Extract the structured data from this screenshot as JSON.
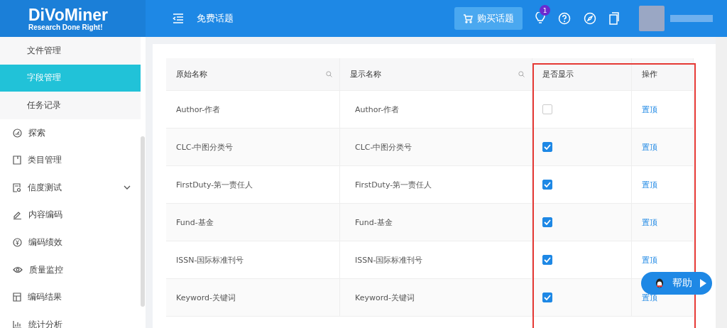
{
  "header": {
    "logo": "DiVoMiner",
    "tagline": "Research Done Right!",
    "page_title": "免费话题",
    "buy_button": "购买话题",
    "notification_badge": "1"
  },
  "sidebar": {
    "items": [
      {
        "label": "文件管理",
        "kind": "sub",
        "selected": false
      },
      {
        "label": "字段管理",
        "kind": "sub",
        "selected": true
      },
      {
        "label": "任务记录",
        "kind": "sub",
        "selected": false
      },
      {
        "label": "探索",
        "kind": "link",
        "selected": false
      },
      {
        "label": "类目管理",
        "kind": "link",
        "selected": false
      },
      {
        "label": "信度测试",
        "kind": "group",
        "selected": false
      },
      {
        "label": "内容编码",
        "kind": "link",
        "selected": false
      },
      {
        "label": "编码绩效",
        "kind": "link",
        "selected": false
      },
      {
        "label": "质量监控",
        "kind": "link",
        "selected": false
      },
      {
        "label": "编码结果",
        "kind": "link",
        "selected": false
      },
      {
        "label": "统计分析",
        "kind": "link",
        "selected": false
      }
    ]
  },
  "table": {
    "columns": [
      "原始名称",
      "显示名称",
      "是否显示",
      "操作"
    ],
    "rows": [
      {
        "original": "Author-作者",
        "display": "Author-作者",
        "shown": false,
        "action": "置顶"
      },
      {
        "original": "CLC-中图分类号",
        "display": "CLC-中图分类号",
        "shown": true,
        "action": "置顶"
      },
      {
        "original": "FirstDuty-第一责任人",
        "display": "FirstDuty-第一责任人",
        "shown": true,
        "action": "置顶"
      },
      {
        "original": "Fund-基金",
        "display": "Fund-基金",
        "shown": true,
        "action": "置顶"
      },
      {
        "original": "ISSN-国际标准刊号",
        "display": "ISSN-国际标准刊号",
        "shown": true,
        "action": "置顶"
      },
      {
        "original": "Keyword-关键词",
        "display": "Keyword-关键词",
        "shown": true,
        "action": "置顶"
      }
    ]
  },
  "help_button": "帮助"
}
